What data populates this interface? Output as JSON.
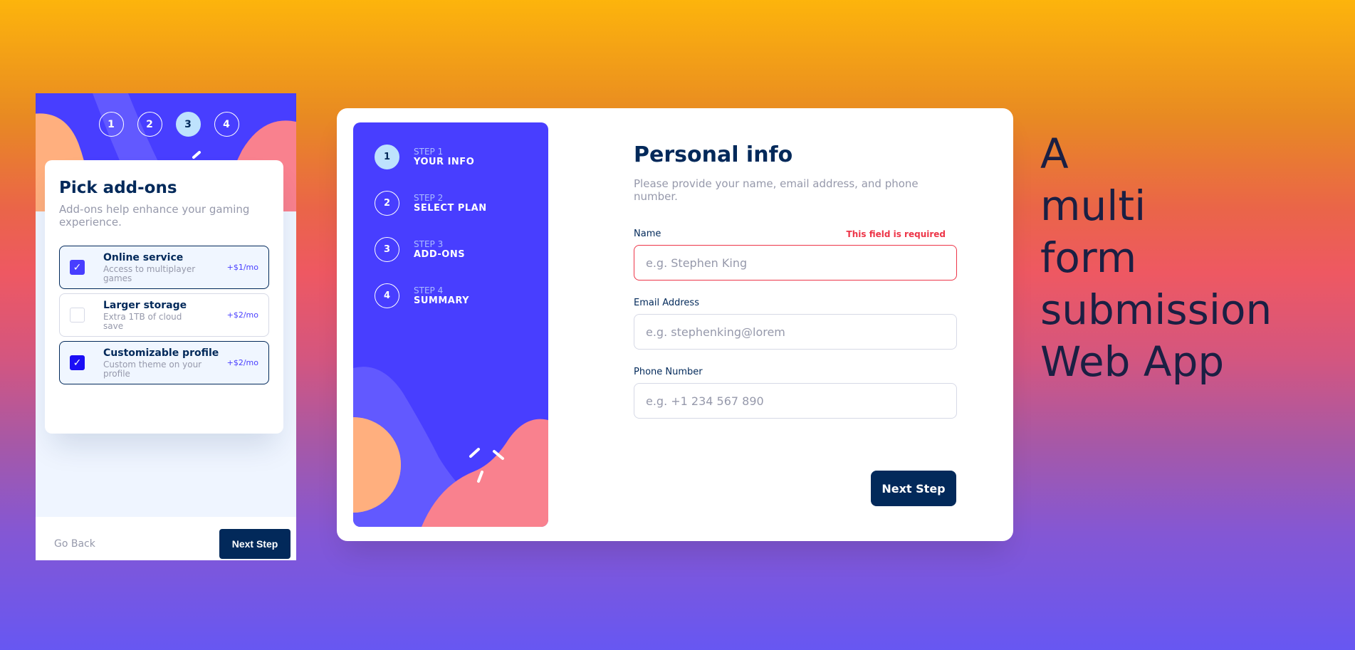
{
  "colors": {
    "primary": "#483eff",
    "marine_blue": "#02295a",
    "light_blue": "#bee2fd",
    "error_red": "#ed3548",
    "cool_gray": "#9699ab",
    "coral": "#f9818e",
    "orange_blob": "#ffaf7e"
  },
  "mobile": {
    "steps": [
      "1",
      "2",
      "3",
      "4"
    ],
    "active_step": 3,
    "title": "Pick add-ons",
    "description": "Add-ons help enhance your gaming experience.",
    "addons": [
      {
        "title": "Online service",
        "subtitle": "Access to multiplayer games",
        "price": "+$1/mo",
        "checked": true
      },
      {
        "title": "Larger storage",
        "subtitle": "Extra 1TB of cloud save",
        "price": "+$2/mo",
        "checked": false
      },
      {
        "title": "Customizable profile",
        "subtitle": "Custom theme on your profile",
        "price": "+$2/mo",
        "checked": true
      }
    ],
    "go_back_label": "Go Back",
    "next_label": "Next Step",
    "check_glyph": "✓"
  },
  "desktop": {
    "steps": [
      {
        "number": "1",
        "small": "STEP 1",
        "big": "YOUR INFO",
        "active": true
      },
      {
        "number": "2",
        "small": "STEP 2",
        "big": "SELECT PLAN",
        "active": false
      },
      {
        "number": "3",
        "small": "STEP 3",
        "big": "ADD-ONS",
        "active": false
      },
      {
        "number": "4",
        "small": "STEP 4",
        "big": "SUMMARY",
        "active": false
      }
    ],
    "title": "Personal info",
    "description": "Please provide your name, email address, and phone number.",
    "fields": [
      {
        "label": "Name",
        "placeholder": "e.g. Stephen King",
        "value": "",
        "error": "This field is required"
      },
      {
        "label": "Email Address",
        "placeholder": "e.g. stephenking@lorem",
        "value": "",
        "error": ""
      },
      {
        "label": "Phone Number",
        "placeholder": "e.g. +1 234 567 890",
        "value": "",
        "error": ""
      }
    ],
    "next_label": "Next Step"
  },
  "hero": {
    "lines": [
      "A",
      "multi",
      "form",
      "submission",
      "Web App"
    ]
  }
}
